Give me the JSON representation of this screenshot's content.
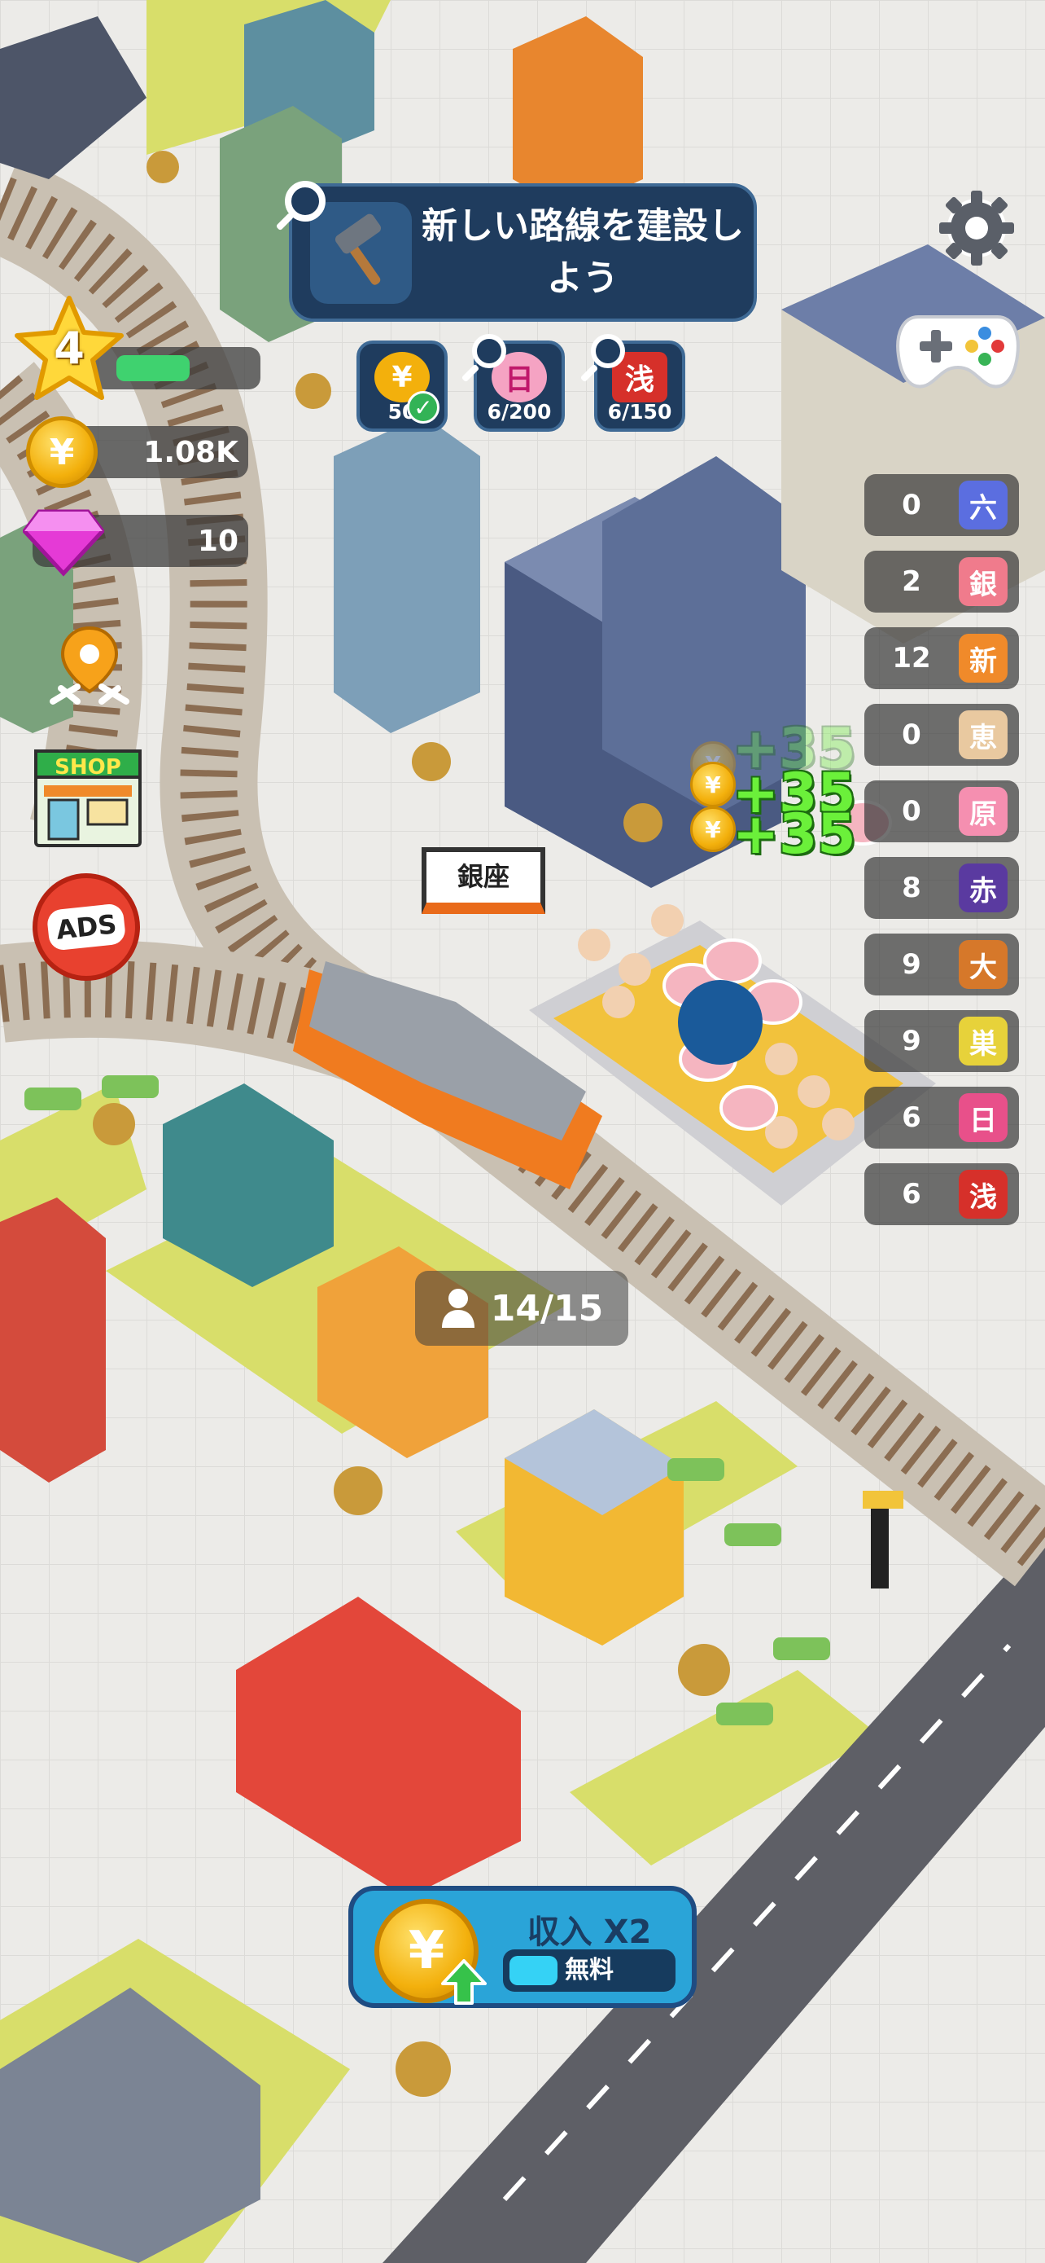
{
  "quest": {
    "title": "新しい路線を建設しよう",
    "goals": [
      {
        "icon": "yen-coin-icon",
        "glyph": "¥",
        "label": "50",
        "complete": true
      },
      {
        "icon": "hinode-icon",
        "glyph": "日",
        "label": "6/200",
        "complete": false
      },
      {
        "icon": "asakusa-icon",
        "glyph": "浅",
        "label": "6/150",
        "complete": false
      }
    ]
  },
  "player": {
    "level": "4",
    "level_progress": 0.6,
    "coins": "1.08K",
    "gems": "10"
  },
  "ads_label": "ADS",
  "shop_label": "SHOP",
  "resources": [
    {
      "count": "0",
      "glyph": "六",
      "color": "#5b6ee0"
    },
    {
      "count": "2",
      "glyph": "銀",
      "color": "#f07b8c"
    },
    {
      "count": "12",
      "glyph": "新",
      "color": "#f08a2a"
    },
    {
      "count": "0",
      "glyph": "恵",
      "color": "#e9c9a0"
    },
    {
      "count": "0",
      "glyph": "原",
      "color": "#f58fb0"
    },
    {
      "count": "8",
      "glyph": "赤",
      "color": "#5a3aa0"
    },
    {
      "count": "9",
      "glyph": "大",
      "color": "#d6782a"
    },
    {
      "count": "9",
      "glyph": "巣",
      "color": "#e7d23a"
    },
    {
      "count": "6",
      "glyph": "日",
      "color": "#e8508a"
    },
    {
      "count": "6",
      "glyph": "浅",
      "color": "#d6302a"
    }
  ],
  "station": {
    "name": "銀座"
  },
  "train": {
    "passengers": "14/15"
  },
  "floating_rewards": [
    "+35",
    "+35",
    "+35"
  ],
  "income_boost": {
    "title": "収入 X2",
    "button": "無料",
    "progress": 0.3
  },
  "colors": {
    "panel_dark": "#1f3c5e",
    "coin_gold": "#f3b00c",
    "level_green": "#3fd26f",
    "accent_blue": "#2aa4d8"
  }
}
